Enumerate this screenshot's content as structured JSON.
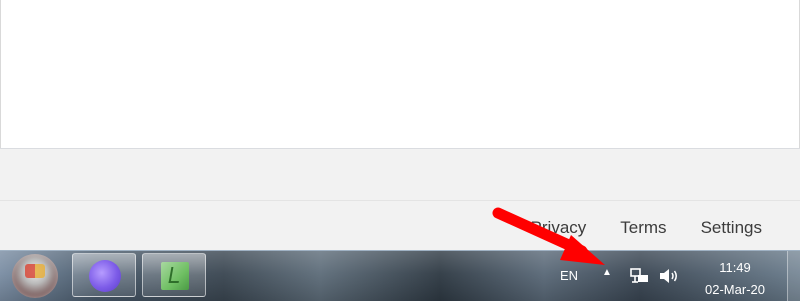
{
  "footer": {
    "links": {
      "privacy": "Privacy",
      "terms": "Terms",
      "settings": "Settings"
    }
  },
  "taskbar": {
    "language": "EN",
    "clock": {
      "time": "11:49",
      "date": "02-Mar-20"
    }
  },
  "colors": {
    "annotation_arrow": "#ff0000",
    "footer_background": "#f2f2f2"
  },
  "icons": {
    "start": "windows-start-orb",
    "app1": "purple-circle-app-icon",
    "app2": "green-app-icon",
    "tray_expand": "triangle-up-icon",
    "network": "network-icon",
    "volume": "speaker-icon"
  }
}
